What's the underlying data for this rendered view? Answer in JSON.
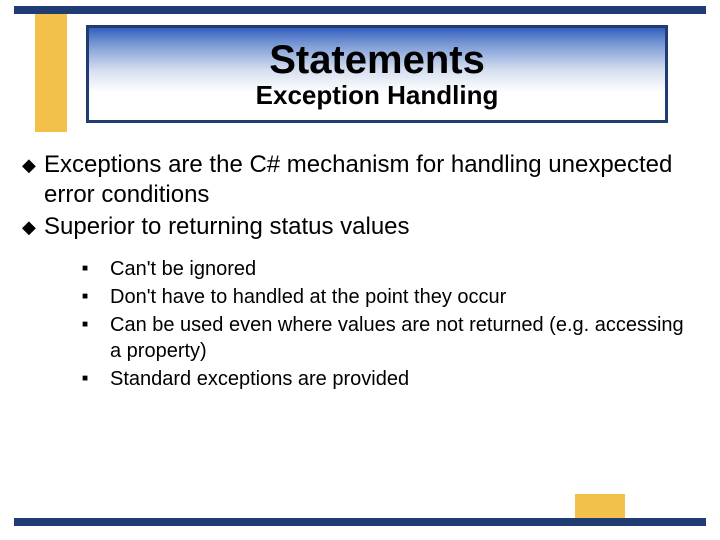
{
  "header": {
    "title": "Statements",
    "subtitle": "Exception Handling"
  },
  "bullets": [
    {
      "text": "Exceptions are the C# mechanism for handling unexpected error conditions"
    },
    {
      "text": "Superior to returning status values"
    }
  ],
  "subbullets": [
    {
      "text": "Can't be ignored"
    },
    {
      "text": "Don't have to handled at the point they occur"
    },
    {
      "text": "Can be used even where values are not returned (e.g. accessing a property)"
    },
    {
      "text": "Standard exceptions are provided"
    }
  ]
}
